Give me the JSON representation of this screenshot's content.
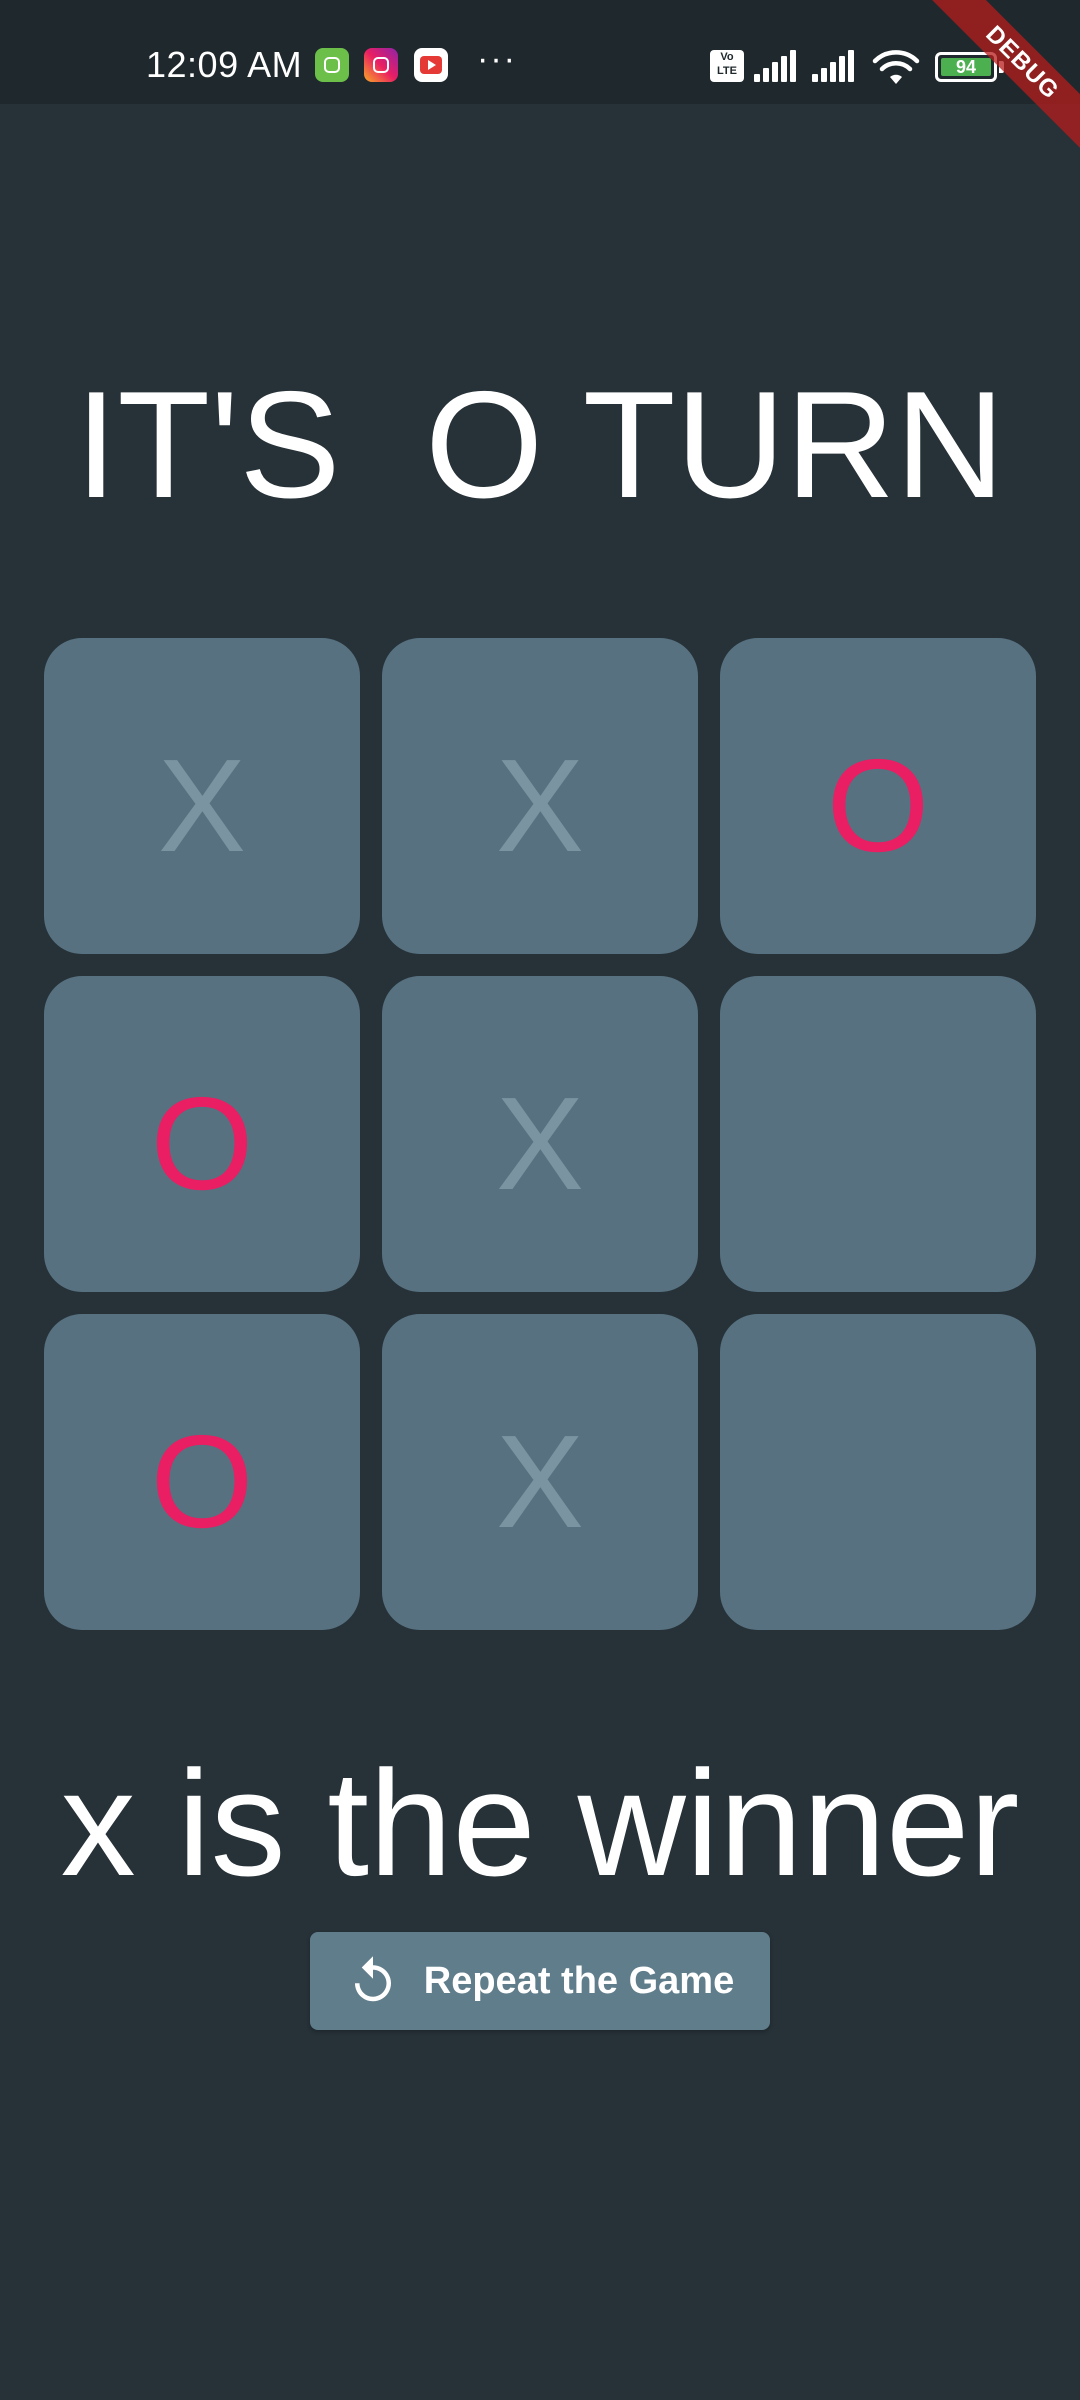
{
  "status_bar": {
    "time": "12:09 AM",
    "more": "···",
    "volte_top": "Vo",
    "volte_bottom": "LTE",
    "battery_level": "94",
    "notification_icons": [
      "android-app-icon",
      "instagram-icon",
      "youtube-icon"
    ]
  },
  "debug_banner": "DEBUG",
  "game": {
    "turn_title": "IT'S  O TURN",
    "board": [
      "X",
      "X",
      "O",
      "O",
      "X",
      "",
      "O",
      "X",
      ""
    ],
    "winner_text": "x is the winner",
    "repeat_label": "Repeat the Game",
    "repeat_icon": "replay-icon"
  },
  "colors": {
    "background": "#263238",
    "cell": "#577180",
    "x_mark": "#7b94a1",
    "o_mark": "#e91e63",
    "button": "#607d8b"
  }
}
